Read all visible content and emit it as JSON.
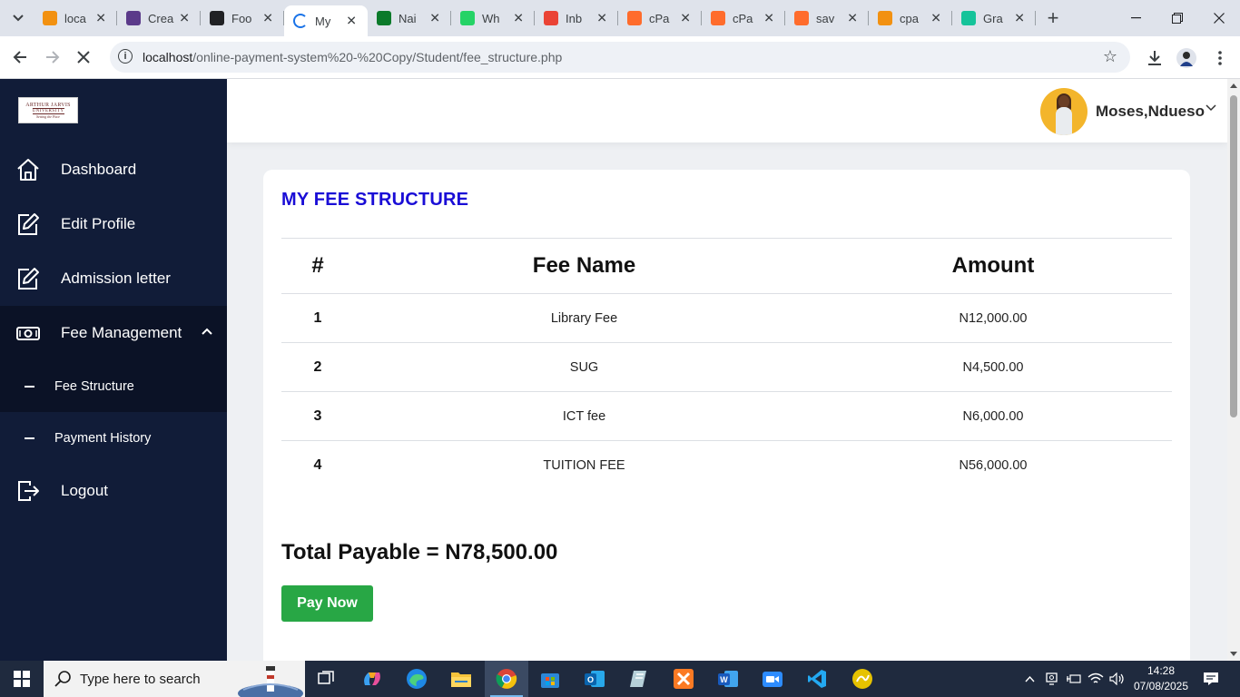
{
  "browser": {
    "tabs": [
      {
        "title": "loca",
        "favicon": "pma-icon",
        "color": "#f29111"
      },
      {
        "title": "Crea",
        "favicon": "figma-like-icon",
        "color": "#5b3a8a"
      },
      {
        "title": "Foo",
        "favicon": "chatgpt-icon",
        "color": "#202124"
      },
      {
        "title": "My",
        "favicon": "loading-icon",
        "color": "#1a73e8",
        "active": true
      },
      {
        "title": "Nai",
        "favicon": "nairaland-icon",
        "color": "#0b7a2a"
      },
      {
        "title": "Wh",
        "favicon": "whatsapp-icon",
        "color": "#25d366"
      },
      {
        "title": "Inb",
        "favicon": "gmail-icon",
        "color": "#ea4335"
      },
      {
        "title": "cPa",
        "favicon": "cpanel-icon",
        "color": "#ff6c2c"
      },
      {
        "title": "cPa",
        "favicon": "cpanel-icon",
        "color": "#ff6c2c"
      },
      {
        "title": "sav",
        "favicon": "cpanel-icon",
        "color": "#ff6c2c"
      },
      {
        "title": "cpa",
        "favicon": "pma-icon",
        "color": "#f29111"
      },
      {
        "title": "Gra",
        "favicon": "grammarly-icon",
        "color": "#15c39a"
      }
    ],
    "url_host": "localhost",
    "url_path": "/online-payment-system%20-%20Copy/Student/fee_structure.php"
  },
  "sidebar": {
    "logo": {
      "line1": "ARTHUR JARVIS",
      "line2": "UNIVERSITY",
      "line3": "Setting the Pace"
    },
    "items": [
      {
        "label": "Dashboard",
        "icon": "home-icon"
      },
      {
        "label": "Edit Profile",
        "icon": "edit-icon"
      },
      {
        "label": "Admission letter",
        "icon": "edit-icon"
      },
      {
        "label": "Fee Management",
        "icon": "money-icon"
      },
      {
        "label": "Logout",
        "icon": "logout-icon"
      }
    ],
    "sub_items": [
      {
        "label": "Fee Structure",
        "active": true
      },
      {
        "label": "Payment History",
        "active": false
      }
    ]
  },
  "header": {
    "user_name": "Moses,Ndueso"
  },
  "main": {
    "title": "MY FEE STRUCTURE",
    "columns": [
      "#",
      "Fee Name",
      "Amount"
    ],
    "rows": [
      {
        "num": "1",
        "name": "Library Fee",
        "amount": "N12,000.00"
      },
      {
        "num": "2",
        "name": "SUG",
        "amount": "N4,500.00"
      },
      {
        "num": "3",
        "name": "ICT fee",
        "amount": "N6,000.00"
      },
      {
        "num": "4",
        "name": "TUITION FEE",
        "amount": "N56,000.00"
      }
    ],
    "total_label": "Total Payable = N78,500.00",
    "pay_button": "Pay Now"
  },
  "taskbar": {
    "search_placeholder": "Type here to search",
    "time": "14:28",
    "date": "07/08/2025"
  },
  "colors": {
    "sidebar_bg": "#111c38",
    "title_blue": "#1a0dd6",
    "pay_green": "#28a745"
  }
}
